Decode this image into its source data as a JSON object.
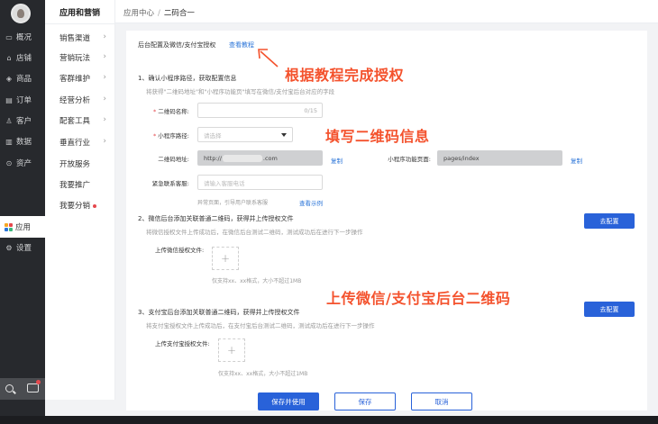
{
  "dark_sidebar": {
    "items": [
      {
        "icon": "monitor-icon",
        "glyph": "▭",
        "label": "概况"
      },
      {
        "icon": "store-icon",
        "glyph": "⌂",
        "label": "店铺"
      },
      {
        "icon": "tag-icon",
        "glyph": "◈",
        "label": "商品"
      },
      {
        "icon": "order-icon",
        "glyph": "▤",
        "label": "订单"
      },
      {
        "icon": "customer-icon",
        "glyph": "♙",
        "label": "客户"
      },
      {
        "icon": "data-icon",
        "glyph": "▥",
        "label": "数据"
      },
      {
        "icon": "asset-icon",
        "glyph": "⊙",
        "label": "资产"
      },
      {
        "icon": "apps-icon",
        "glyph": "",
        "label": "应用"
      },
      {
        "icon": "settings-icon",
        "glyph": "⚙",
        "label": "设置"
      }
    ]
  },
  "sec_sidebar": {
    "title": "应用和营销",
    "items": [
      {
        "label": "销售渠道",
        "chevron": "›"
      },
      {
        "label": "营销玩法",
        "chevron": "›"
      },
      {
        "label": "客群维护",
        "chevron": "›"
      },
      {
        "label": "经营分析",
        "chevron": "›"
      },
      {
        "label": "配套工具",
        "chevron": "›"
      },
      {
        "label": "垂直行业",
        "chevron": "›"
      },
      {
        "label": "开放服务",
        "chevron": ""
      },
      {
        "label": "我要推广",
        "chevron": ""
      },
      {
        "label": "我要分销",
        "chevron": ""
      }
    ]
  },
  "breadcrumb": {
    "parent": "应用中心",
    "separator": "/",
    "current": "二码合一"
  },
  "form": {
    "header": "后台配置及微信/支付宝授权",
    "tutorial_link": "查看教程",
    "step1": {
      "title": "1、确认小程序路径，获取配置信息",
      "desc": "将获得\"二维码地址\"和\"小程序功能页\"填写在微信/支付宝后台对应的字段",
      "name_label": "二维码名称:",
      "name_counter": "0/15",
      "path_label": "小程序路径:",
      "path_placeholder": "请选择",
      "qr_label": "二维码地址:",
      "qr_prefix": "http://",
      "qr_suffix": ".com",
      "copy1": "复制",
      "mini_label": "小程序功能页面:",
      "mini_value": "pages/index",
      "copy2": "复制",
      "contact_label": "紧急联系客服:",
      "contact_placeholder": "请输入客服电话",
      "contact_hint": "异常页面，引导用户联系客服",
      "example_link": "查看示例"
    },
    "step2": {
      "title": "2、微信后台添加关联普通二维码，获得并上传授权文件",
      "desc": "将微信授权文件上传成功后，在微信后台测试二维码，测试成功后在进行下一步操作",
      "button": "去配置",
      "upload_label": "上传微信授权文件:",
      "upload_plus": "+",
      "upload_hint": "仅支持xx、xx格式，大小不超过1MB"
    },
    "step3": {
      "title": "3、支付宝后台添加关联普通二维码，获得并上传授权文件",
      "desc": "将支付宝授权文件上传成功后，在支付宝后台测试二维码，测试成功后在进行下一步操作",
      "button": "去配置",
      "upload_label": "上传支付宝授权文件:",
      "upload_plus": "+",
      "upload_hint": "仅支持xx、xx格式，大小不超过1MB"
    },
    "footer": {
      "save_use": "保存并使用",
      "save": "保存",
      "cancel": "取消"
    }
  },
  "annotations": {
    "a1": "根据教程完成授权",
    "a2": "填写二维码信息",
    "a3": "上传微信/支付宝后台二维码"
  },
  "colors": {
    "accent": "#2962d9",
    "annotation": "#f4522d",
    "dark_sidebar": "#27292d"
  }
}
